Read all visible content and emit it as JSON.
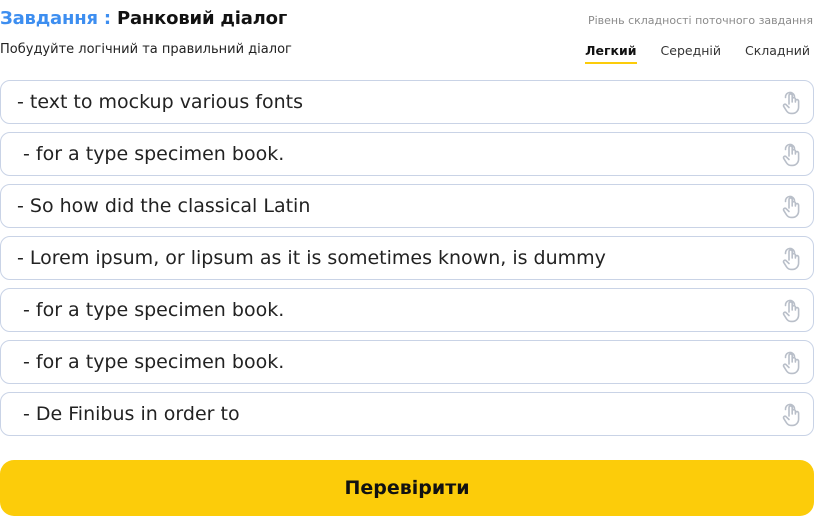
{
  "header": {
    "title_prefix": "Завдання :",
    "title_name": "Ранковий діалог",
    "subtitle": "Побудуйте логічний та правильний діалог",
    "level_caption": "Рівень складності поточного завдання",
    "levels": [
      {
        "label": "Легкий",
        "active": true
      },
      {
        "label": "Середній",
        "active": false
      },
      {
        "label": "Складний",
        "active": false
      }
    ]
  },
  "lines": [
    {
      "text": "- text to mockup various fonts"
    },
    {
      "text": " - for a type specimen book."
    },
    {
      "text": "- So how did the classical Latin"
    },
    {
      "text": "- Lorem ipsum, or lipsum as it is sometimes known, is dummy"
    },
    {
      "text": " - for a type specimen book."
    },
    {
      "text": " - for a type specimen book."
    },
    {
      "text": " - De Finibus in order to"
    }
  ],
  "line_icon": "drag-hand-icon",
  "check_button": {
    "label": "Перевірити"
  },
  "colors": {
    "accent_blue": "#3d8ef0",
    "button_yellow": "#fccc0a",
    "line_border": "#c9d3e6",
    "icon_gray": "#b9bfc9"
  }
}
